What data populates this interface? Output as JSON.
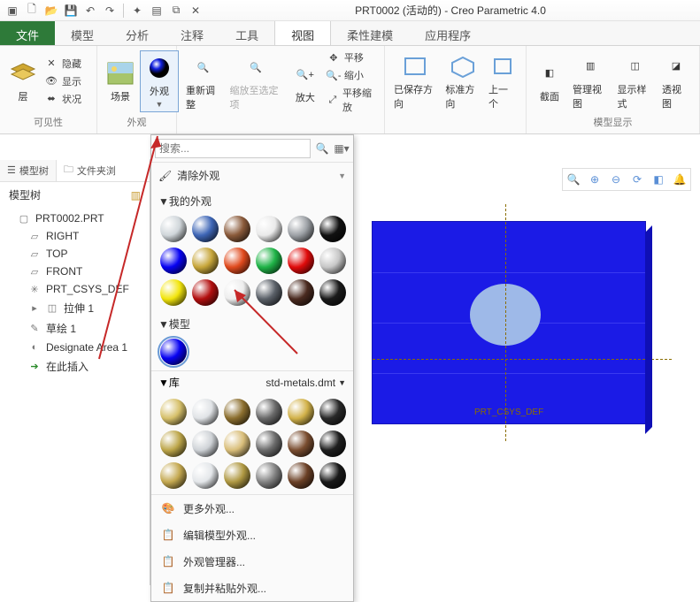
{
  "title": "PRT0002 (活动的) - Creo Parametric 4.0",
  "tabs": {
    "file": "文件",
    "model": "模型",
    "analysis": "分析",
    "annotate": "注释",
    "tools": "工具",
    "view": "视图",
    "flex": "柔性建模",
    "apps": "应用程序"
  },
  "ribbon": {
    "visibility": {
      "label": "可见性",
      "layer": "层",
      "hide": "隐藏",
      "show": "显示",
      "status": "状况"
    },
    "appearance": {
      "label": "外观",
      "scene": "场景",
      "appearance_btn": "外观"
    },
    "orient": {
      "refit": "重新调整",
      "zoomfit": "缩放至选定项",
      "zoomin": "放大",
      "pan": "平移",
      "zoomout": "缩小",
      "panzoom": "平移缩放"
    },
    "view": {
      "saved": "已保存方向",
      "std": "标准方向",
      "prev": "上一个"
    },
    "display": {
      "label": "模型显示",
      "section": "截面",
      "mgr": "管理视图",
      "style": "显示样式",
      "persp": "透视图"
    }
  },
  "tree": {
    "tab_model": "模型树",
    "tab_folder": "文件夹浏",
    "header": "模型树",
    "items": {
      "prt": "PRT0002.PRT",
      "right": "RIGHT",
      "top": "TOP",
      "front": "FRONT",
      "csys": "PRT_CSYS_DEF",
      "extrude": "拉伸 1",
      "sketch": "草绘 1",
      "designate": "Designate Area 1",
      "insert": "在此插入"
    }
  },
  "popup": {
    "search_placeholder": "搜索...",
    "clear": "清除外观",
    "section_my": "▼我的外观",
    "section_model": "▼模型",
    "section_lib": "▼库",
    "lib_name": "std-metals.dmt",
    "more": "更多外观...",
    "edit_model": "编辑模型外观...",
    "mgr": "外观管理器...",
    "copy_paste": "复制并粘贴外观..."
  },
  "viewport": {
    "csys_label": "PRT_CSYS_DEF"
  },
  "swatches_my": [
    "#d0d6da",
    "#3e66b6",
    "#8a5a3a",
    "#eaeaea",
    "#9da1a6",
    "#111",
    "#0702f2",
    "#c7a63a",
    "#e04a1d",
    "#1fb347",
    "#e00b0b",
    "#c7c7c7",
    "#f2e50c",
    "#b20f0f",
    "#ededed",
    "#5a6068",
    "#4a2a1f",
    "#1a1a1a"
  ],
  "swatches_lib": [
    "#d6c06a",
    "#e0e3e6",
    "#8c6f2f",
    "#6a6a6a",
    "#d2b24a",
    "#292929",
    "#bda64a",
    "#cfd3d7",
    "#d9be7a",
    "#6c6c6c",
    "#7a4d30",
    "#1f1f1f",
    "#c4a850",
    "#e4e7ea",
    "#af9842",
    "#838383",
    "#6b4026",
    "#191919"
  ]
}
